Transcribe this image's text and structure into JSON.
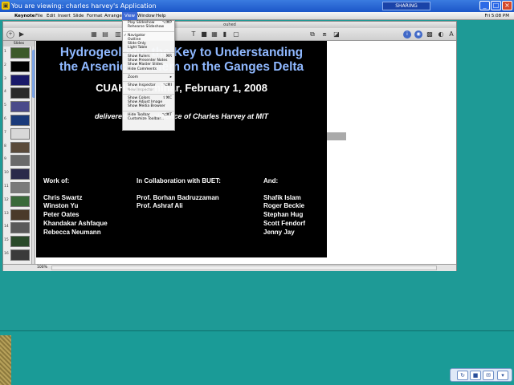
{
  "viewer": {
    "title": "You are viewing: charles harvey's Application",
    "sharing_label": "SHARING",
    "minimize_glyph": "_",
    "maximize_glyph": "□",
    "close_glyph": "×"
  },
  "menubar": {
    "apple_glyph": "",
    "app_name": "Keynote",
    "items": [
      "File",
      "Edit",
      "Insert",
      "Slide",
      "Format",
      "Arrange",
      "View",
      "Window",
      "Help"
    ],
    "status": "Fri 5:08 PM"
  },
  "window": {
    "title": "ouhed"
  },
  "toolbar_icons": [
    "new-slide-icon",
    "play-icon",
    "view-icon",
    "text-icon",
    "shapes-icon",
    "table-icon",
    "chart-icon",
    "comment-icon",
    "inspector-icon",
    "media-icon",
    "colors-icon",
    "fonts-icon"
  ],
  "view_menu": {
    "items": [
      {
        "label": "Play Slideshow",
        "shortcut": "⌥⌘P"
      },
      {
        "label": "Rehearse Slideshow",
        "shortcut": ""
      },
      {
        "sep": true
      },
      {
        "label": "Navigator",
        "checked": true
      },
      {
        "label": "Outline"
      },
      {
        "label": "Slide Only"
      },
      {
        "label": "Light Table"
      },
      {
        "sep": true
      },
      {
        "label": "Show Rulers",
        "shortcut": "⌘R"
      },
      {
        "label": "Show Presenter Notes"
      },
      {
        "label": "Show Master Slides"
      },
      {
        "label": "Hide Comments"
      },
      {
        "sep": true
      },
      {
        "label": "Zoom",
        "shortcut": "▸"
      },
      {
        "sep": true
      },
      {
        "label": "Show Inspector",
        "shortcut": "⌥⌘I"
      },
      {
        "label": "New Inspector",
        "disabled": true
      },
      {
        "sep": true
      },
      {
        "label": "Show Colors",
        "shortcut": "⇧⌘C"
      },
      {
        "label": "Show Adjust Image"
      },
      {
        "label": "Show Media Browser"
      },
      {
        "sep": true
      },
      {
        "label": "Hide Toolbar",
        "shortcut": "⌥⌘T"
      },
      {
        "label": "Customize Toolbar..."
      }
    ]
  },
  "navigator": {
    "header": "Slides",
    "thumb_colors": [
      "#3c5a2a",
      "#000000",
      "#1a1a6a",
      "#2a2a2a",
      "#4a4a8a",
      "#1a3a7a",
      "#d8d8d8",
      "#5a4a3a",
      "#6a6a6a",
      "#2a2a4a",
      "#7a7a7a",
      "#3a6a3a",
      "#4a3a2a",
      "#5a5a5a",
      "#2a4a2a",
      "#3a3a3a"
    ]
  },
  "slide": {
    "title_line1": "Hydrogeology: the Key to Understanding",
    "title_line2": "the Arsenic Problem on the Ganges Delta",
    "date": "CUAHSI Seminar,  February 1, 2008",
    "credit": "delivered for the absence of Charles Harvey at MIT",
    "col1": {
      "head": "Work of:",
      "names": [
        "Chris Swartz",
        "Winston Yu",
        "Peter Oates",
        "Khandakar Ashfaque",
        "Rebecca Neumann"
      ]
    },
    "col2": {
      "head": "In Collaboration with BUET:",
      "names": [
        "Prof. Borhan Badruzzaman",
        "Prof. Ashraf Ali"
      ]
    },
    "col3": {
      "head": "And:",
      "names": [
        "Shafik Islam",
        "Roger Beckie",
        "Stephan Hug",
        "Scott Fendorf",
        "Jenny Jay"
      ]
    }
  },
  "statusbar": {
    "zoom": "100%"
  },
  "tray_icons": [
    "refresh-icon",
    "stop-icon",
    "chat-icon",
    "dropdown-icon"
  ]
}
